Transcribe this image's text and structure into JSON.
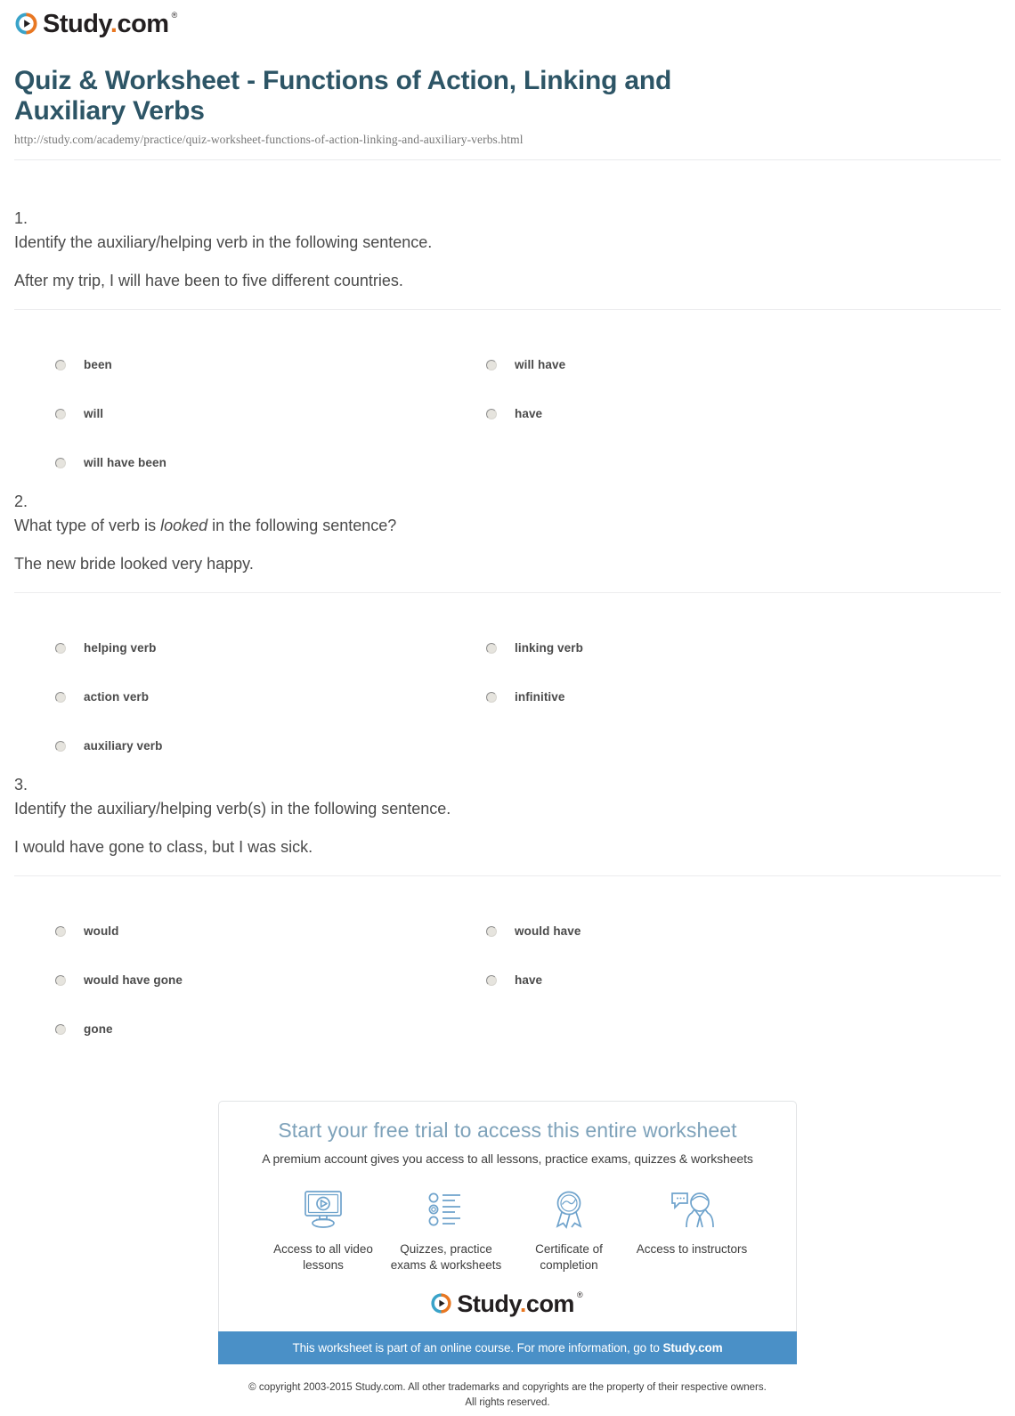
{
  "brand": {
    "logo_text_main": "Study",
    "logo_text_dot": ".",
    "logo_text_suffix": "com",
    "logo_tm": "®",
    "accent_blue": "#4a90c7",
    "accent_orange": "#e87722",
    "title_color": "#2d5566"
  },
  "header": {
    "title": "Quiz & Worksheet - Functions of Action, Linking and Auxiliary Verbs",
    "url": "http://study.com/academy/practice/quiz-worksheet-functions-of-action-linking-and-auxiliary-verbs.html"
  },
  "questions": [
    {
      "number": "1.",
      "prompt_before": "Identify the auxiliary/helping verb in the following sentence.",
      "prompt_italic": "",
      "prompt_after": "",
      "sentence": "After my trip, I will have been to five different countries.",
      "options_left": [
        "been",
        "will",
        "will have been"
      ],
      "options_right": [
        "will have",
        "have"
      ]
    },
    {
      "number": "2.",
      "prompt_before": "What type of verb is ",
      "prompt_italic": "looked",
      "prompt_after": " in the following sentence?",
      "sentence": "The new bride looked very happy.",
      "options_left": [
        "helping verb",
        "action verb",
        "auxiliary verb"
      ],
      "options_right": [
        "linking verb",
        "infinitive"
      ]
    },
    {
      "number": "3.",
      "prompt_before": "Identify the auxiliary/helping verb(s) in the following sentence.",
      "prompt_italic": "",
      "prompt_after": "",
      "sentence": "I would have gone to class, but I was sick.",
      "options_left": [
        "would",
        "would have gone",
        "gone"
      ],
      "options_right": [
        "would have",
        "have"
      ]
    }
  ],
  "promo": {
    "heading": "Start your free trial to access this entire worksheet",
    "subheading": "A premium account gives you access to all lessons, practice exams, quizzes & worksheets",
    "features": [
      {
        "icon": "monitor-play-icon",
        "label": "Access to all video lessons"
      },
      {
        "icon": "checklist-icon",
        "label": "Quizzes, practice exams & worksheets"
      },
      {
        "icon": "award-ribbon-icon",
        "label": "Certificate of completion"
      },
      {
        "icon": "instructor-chat-icon",
        "label": "Access to instructors"
      }
    ],
    "banner_text": "This worksheet is part of an online course. For more information, go to ",
    "banner_link": "Study.com"
  },
  "footer": {
    "copyright_line1": "© copyright 2003-2015 Study.com. All other trademarks and copyrights are the property of their respective owners.",
    "copyright_line2": "All rights reserved."
  }
}
